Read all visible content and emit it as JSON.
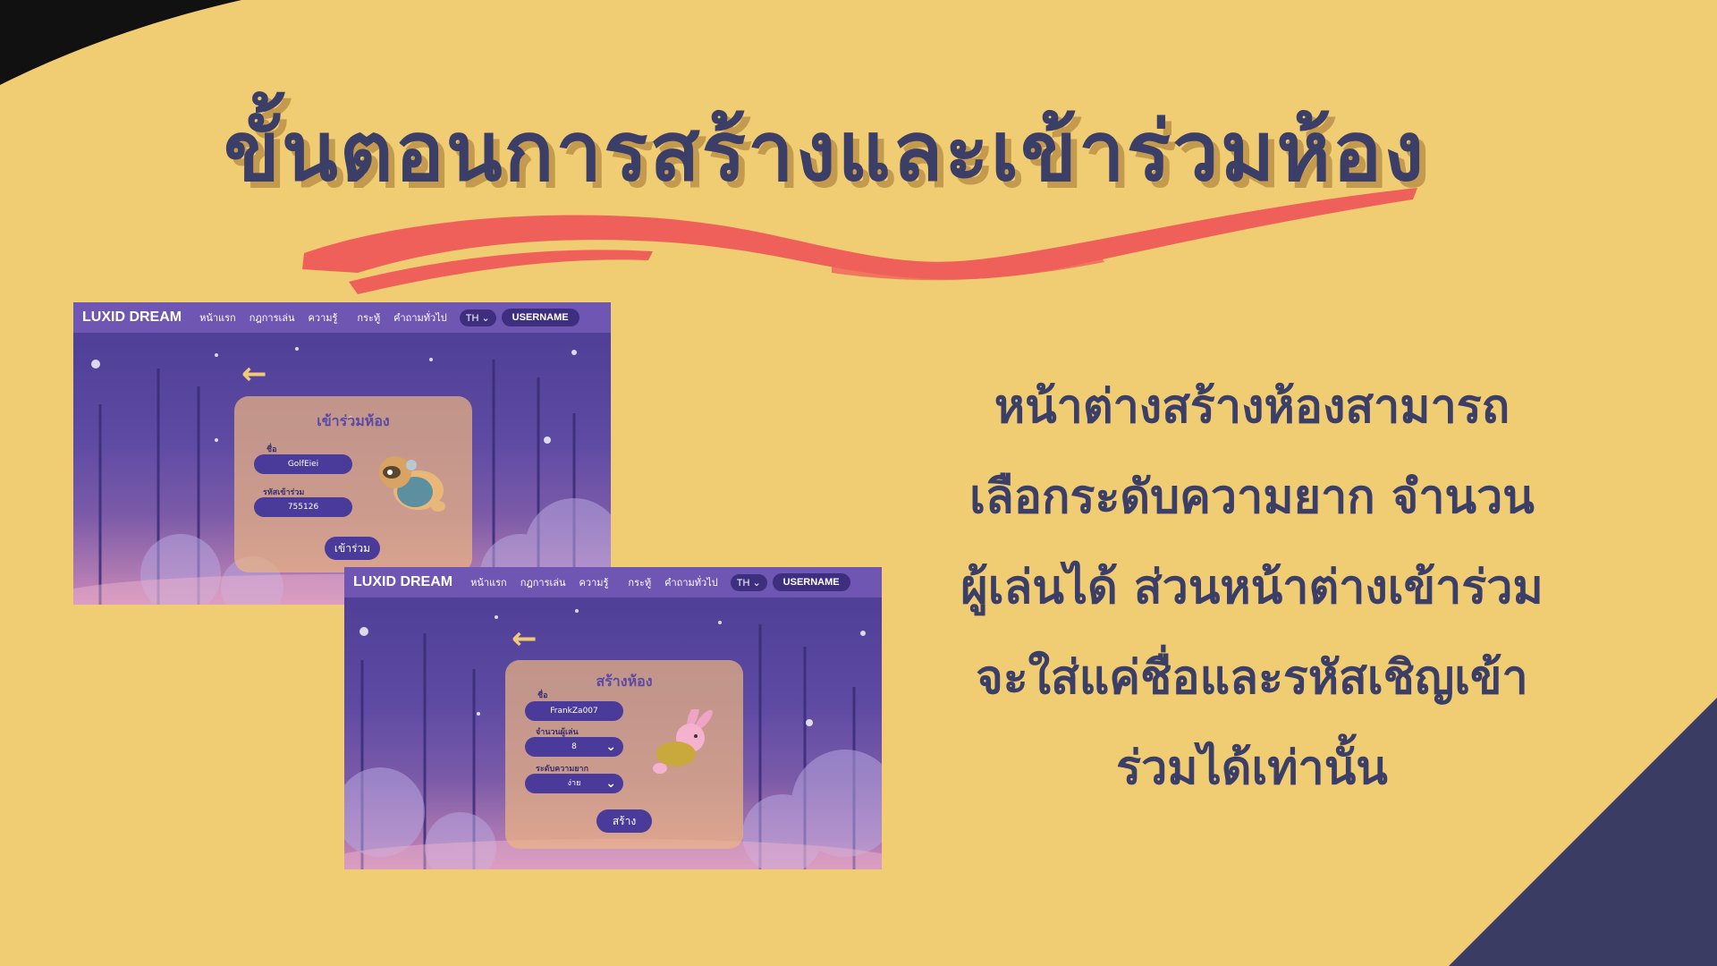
{
  "title": "ขั้นตอนการสร้างและเข้าร่วมห้อง",
  "description_lines": [
    "หน้าต่างสร้างห้องสามารถ",
    "เลือกระดับความยาก จำนวน",
    "ผู้เล่นได้ ส่วนหน้าต่างเข้าร่วม",
    "จะใส่แค่ชื่อและรหัสเชิญเข้า",
    "ร่วมได้เท่านั้น"
  ],
  "nav": {
    "brand": "LUXID DREAM",
    "links": [
      "หน้าแรก",
      "กฎการเล่น",
      "ความรู้",
      "กระทู้",
      "คำถามทั่วไป"
    ],
    "lang": "TH",
    "username": "USERNAME"
  },
  "join_room": {
    "title": "เข้าร่วมห้อง",
    "name_label": "ชื่อ",
    "name_value": "GolfEiei",
    "code_label": "รหัสเข้าร่วม",
    "code_value": "755126",
    "button": "เข้าร่วม"
  },
  "create_room": {
    "title": "สร้างห้อง",
    "name_label": "ชื่อ",
    "name_value": "FrankZa007",
    "players_label": "จำนวนผู้เล่น",
    "players_value": "8",
    "difficulty_label": "ระดับความยาก",
    "difficulty_value": "ง่าย",
    "button": "สร้าง"
  },
  "colors": {
    "background": "#f0cc72",
    "title_text": "#3b3e66",
    "brush_stroke": "#f0605a",
    "navy_corner": "#3b3c63"
  }
}
